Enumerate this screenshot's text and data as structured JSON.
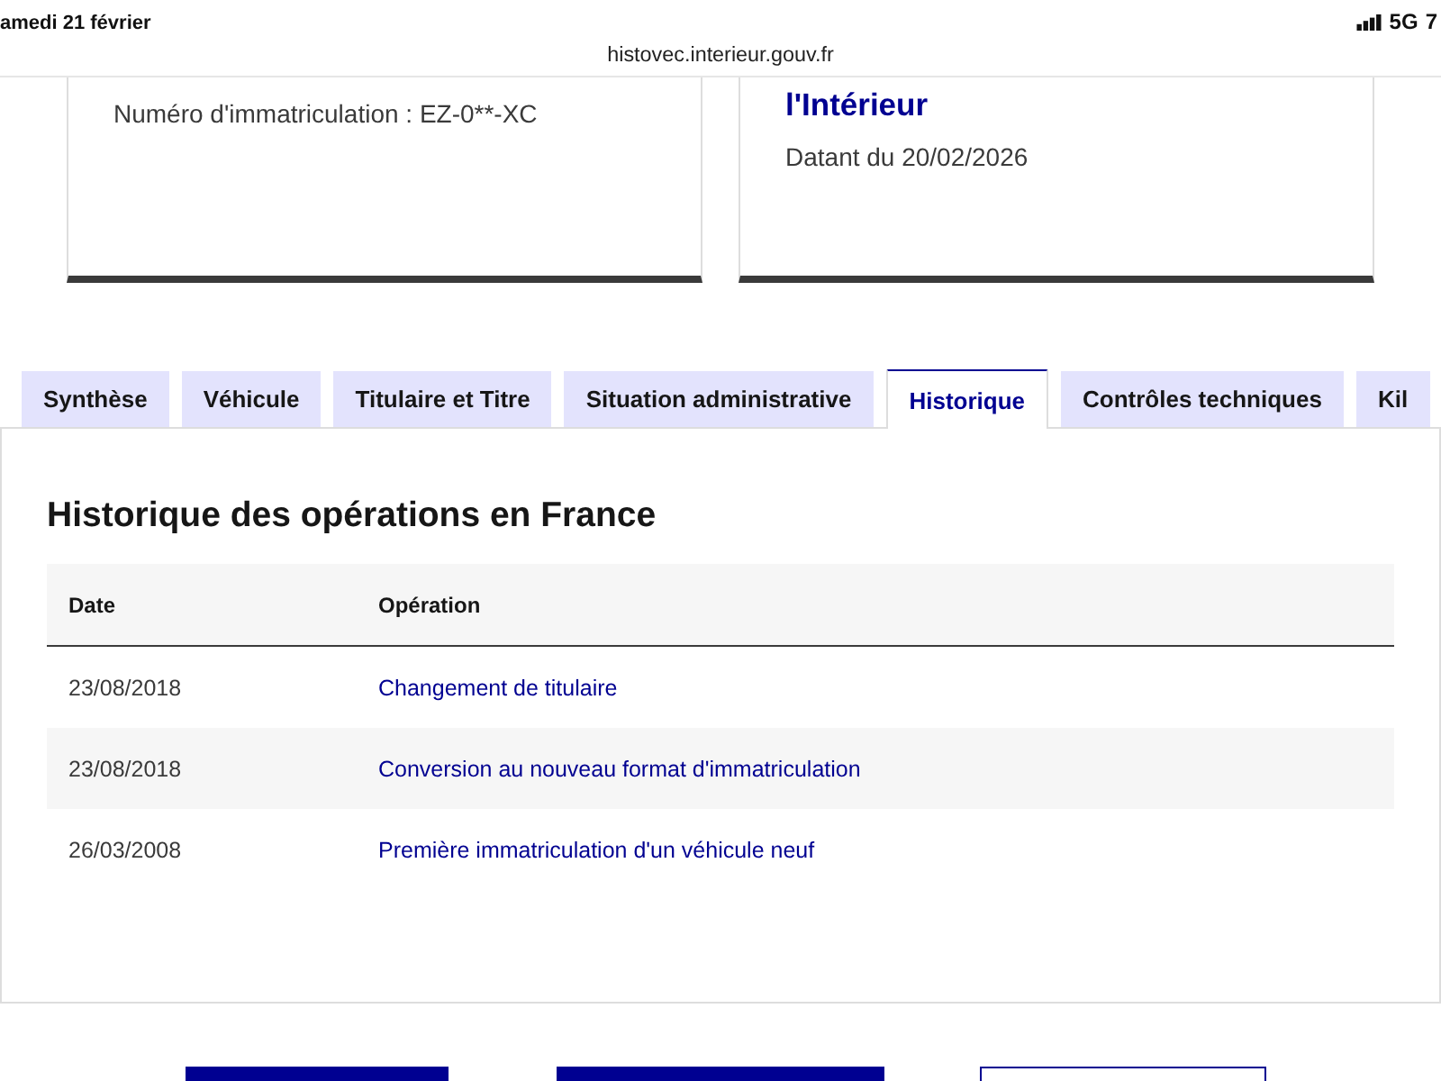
{
  "status_bar": {
    "date": "amedi 21 février",
    "network": "5G",
    "battery": "7"
  },
  "address_bar": {
    "url": "histovec.interieur.gouv.fr"
  },
  "cards": [
    {
      "lines": [
        {
          "kind": "text",
          "text": "Numéro d'immatriculation : EZ-0**-XC"
        }
      ]
    },
    {
      "lines": [
        {
          "kind": "title",
          "text": "l'Intérieur"
        },
        {
          "kind": "text",
          "text": "Datant du 20/02/2026"
        }
      ]
    }
  ],
  "tabs": [
    {
      "label": "Synthèse",
      "selected": false
    },
    {
      "label": "Véhicule",
      "selected": false
    },
    {
      "label": "Titulaire et Titre",
      "selected": false
    },
    {
      "label": "Situation administrative",
      "selected": false
    },
    {
      "label": "Historique",
      "selected": true
    },
    {
      "label": "Contrôles techniques",
      "selected": false
    },
    {
      "label": "Kil",
      "selected": false
    }
  ],
  "panel": {
    "title": "Historique des opérations en France",
    "table": {
      "columns": [
        "Date",
        "Opération"
      ],
      "rows": [
        {
          "date": "23/08/2018",
          "operation": "Changement de titulaire"
        },
        {
          "date": "23/08/2018",
          "operation": "Conversion au nouveau format d'immatriculation"
        },
        {
          "date": "26/03/2008",
          "operation": "Première immatriculation d'un véhicule neuf"
        }
      ]
    }
  },
  "buttons": [
    {
      "kind": "primary"
    },
    {
      "kind": "primary"
    },
    {
      "kind": "secondary"
    }
  ]
}
